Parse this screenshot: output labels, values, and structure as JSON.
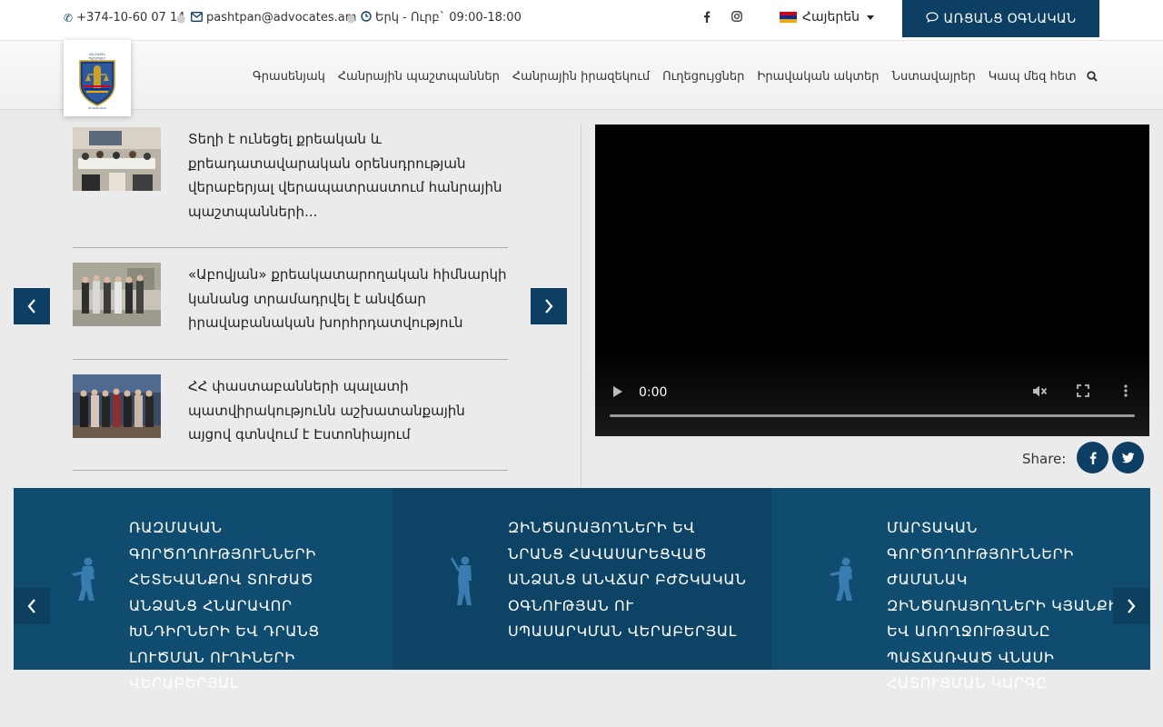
{
  "topbar": {
    "phone": "+374-10-60 07 14",
    "email": "pashtpan@advocates.am",
    "hours": "Երկ - Ուրբ` 09:00-18:00",
    "language": "Հայերեն",
    "online_button": "ԱՌՑԱՆՑ ՕԳՆԱԿԱՆ",
    "social": [
      "facebook-icon",
      "instagram-icon"
    ]
  },
  "nav": {
    "items": [
      "Գրասենյակ",
      "Հանրային պաշտպաններ",
      "Հանրային իրազեկում",
      "Ուղեցույցներ",
      "Իրավական ակտեր",
      "Նստավայրեր",
      "Կապ մեզ հետ"
    ]
  },
  "news": [
    {
      "title": "Տեղի է ունեցել քրեական և քրեադատավարական օրենսդրության վերաբերյալ վերապատրաստում հանրային պաշտպանների..."
    },
    {
      "title": "«Աբովյան» քրեակատարողական հիմնարկի կանանց տրամադրվել է անվճար իրավաբանական խորհրդատվություն"
    },
    {
      "title": "ՀՀ փաստաբանների պալատի պատվիրակությունն աշխատանքային այցով գտնվում է Էստոնիայում"
    }
  ],
  "video": {
    "time": "0:00"
  },
  "share": {
    "label": "Share:",
    "buttons": [
      "facebook-icon",
      "twitter-icon"
    ]
  },
  "cards": [
    {
      "text": "ՌԱԶՄԱԿԱՆ ԳՈՐԾՈՂՈՒԹՅՈՒՆՆԵՐԻ ՀԵՏԵՎԱՆՔՈՎ ՏՈՒԺԱԾ ԱՆՁԱՆՑ ՀՆԱՐԱՎՈՐ ԽՆԴԻՐՆԵՐԻ ԵՎ ԴՐԱՆՑ ԼՈՒԾՄԱՆ ՈՒՂԻՆԵՐԻ ՎԵՐԱԲԵՐՅԱԼ"
    },
    {
      "text": "ԶԻՆԾԱՌԱՅՈՂՆԵՐԻ ԵՎ ՆՐԱՆՑ ՀԱՎԱՍԱՐԵՑՎԱԾ ԱՆՁԱՆՑ ԱՆՎՃԱՐ ԲԺՇԿԱԿԱՆ ՕԳՆՈՒԹՅԱՆ ՈՒ ՍՊԱՍԱՐԿՄԱՆ ՎԵՐԱԲԵՐՅԱԼ"
    },
    {
      "text": "ՄԱՐՏԱԿԱՆ ԳՈՐԾՈՂՈՒԹՅՈՒՆՆԵՐԻ ԺԱՄԱՆԱԿ ԶԻՆԾԱՌԱՅՈՂՆԵՐԻ ԿՅԱՆՔԻՆ ԵՎ ԱՌՈՂՋՈՒԹՅԱՆԸ ՊԱՏՃԱՌՎԱԾ ՎՆԱՍԻ ՀԱՏՈՒՑՄԱՆ ԿԱՐԳԸ"
    }
  ],
  "colors": {
    "primary": "#0c3f63",
    "card_bg": "#0f4c6f",
    "card_bg_alt": "#0d4365",
    "page_bg": "#ebebeb"
  }
}
